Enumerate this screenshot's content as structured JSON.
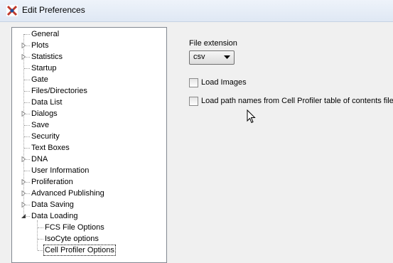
{
  "window": {
    "title": "Edit Preferences",
    "app_icon": "fcs-express-icon"
  },
  "tree": {
    "items": [
      {
        "label": "General",
        "expandable": false
      },
      {
        "label": "Plots",
        "expandable": true
      },
      {
        "label": "Statistics",
        "expandable": true
      },
      {
        "label": "Startup",
        "expandable": false
      },
      {
        "label": "Gate",
        "expandable": false
      },
      {
        "label": "Files/Directories",
        "expandable": false
      },
      {
        "label": "Data List",
        "expandable": false
      },
      {
        "label": "Dialogs",
        "expandable": true
      },
      {
        "label": "Save",
        "expandable": false
      },
      {
        "label": "Security",
        "expandable": false
      },
      {
        "label": "Text Boxes",
        "expandable": false
      },
      {
        "label": "DNA",
        "expandable": true
      },
      {
        "label": "User Information",
        "expandable": false
      },
      {
        "label": "Proliferation",
        "expandable": true
      },
      {
        "label": "Advanced Publishing",
        "expandable": true
      },
      {
        "label": "Data Saving",
        "expandable": true
      },
      {
        "label": "Data Loading",
        "expandable": true,
        "expanded": true
      },
      {
        "label": "FCS File Options",
        "child": true
      },
      {
        "label": "IsoCyte options",
        "child": true
      },
      {
        "label": "Cell Profiler Options",
        "child": true,
        "selected": true
      }
    ]
  },
  "settings": {
    "file_extension_label": "File extension",
    "file_extension_value": "csv",
    "load_images_label": "Load Images",
    "load_images_checked": false,
    "load_paths_label": "Load path names from Cell Profiler table of contents file",
    "load_paths_checked": false
  }
}
